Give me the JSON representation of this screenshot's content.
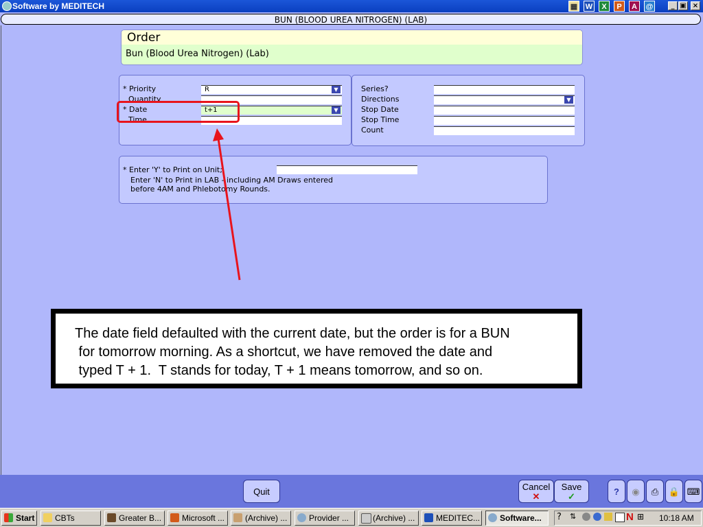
{
  "window": {
    "title": "Software by MEDITECH"
  },
  "header": {
    "title": "BUN (BLOOD UREA NITROGEN) (LAB)"
  },
  "order": {
    "heading": "Order",
    "name": "Bun (Blood Urea Nitrogen) (Lab)"
  },
  "left_fields": {
    "priority": {
      "label": "* Priority",
      "value": "R"
    },
    "quantity": {
      "label": "Quantity",
      "value": ""
    },
    "date": {
      "label": "* Date",
      "value": "t+1"
    },
    "time": {
      "label": "Time",
      "value": ""
    }
  },
  "right_fields": {
    "series": {
      "label": "Series?",
      "value": ""
    },
    "directions": {
      "label": "Directions",
      "value": ""
    },
    "stop_date": {
      "label": "Stop Date",
      "value": ""
    },
    "stop_time": {
      "label": "Stop Time",
      "value": ""
    },
    "count": {
      "label": "Count",
      "value": ""
    }
  },
  "print_panel": {
    "line1": "* Enter 'Y' to Print on Unit;",
    "line2": "Enter 'N' to Print in LAB - including AM Draws entered",
    "line3": "before 4AM and Phlebotomy Rounds.",
    "value": ""
  },
  "callout": {
    "text": "The date field defaulted with the current date, but the order is for a BUN\n for tomorrow morning. As a shortcut, we have removed the date and\n typed T + 1.  T stands for today, T + 1 means tomorrow, and so on."
  },
  "buttons": {
    "quit": "Quit",
    "cancel": "Cancel",
    "save": "Save",
    "help": "?"
  },
  "taskbar": {
    "start": "Start",
    "items": [
      "CBTs",
      "Greater B...",
      "Microsoft ...",
      "(Archive) ...",
      "Provider ...",
      "(Archive) ...",
      "MEDITEC...",
      "Software..."
    ],
    "clock": "10:18 AM"
  },
  "colors": {
    "accent_red": "#e8141c",
    "title_blue": "#0a3fc0",
    "background": "#b0b7fb"
  }
}
